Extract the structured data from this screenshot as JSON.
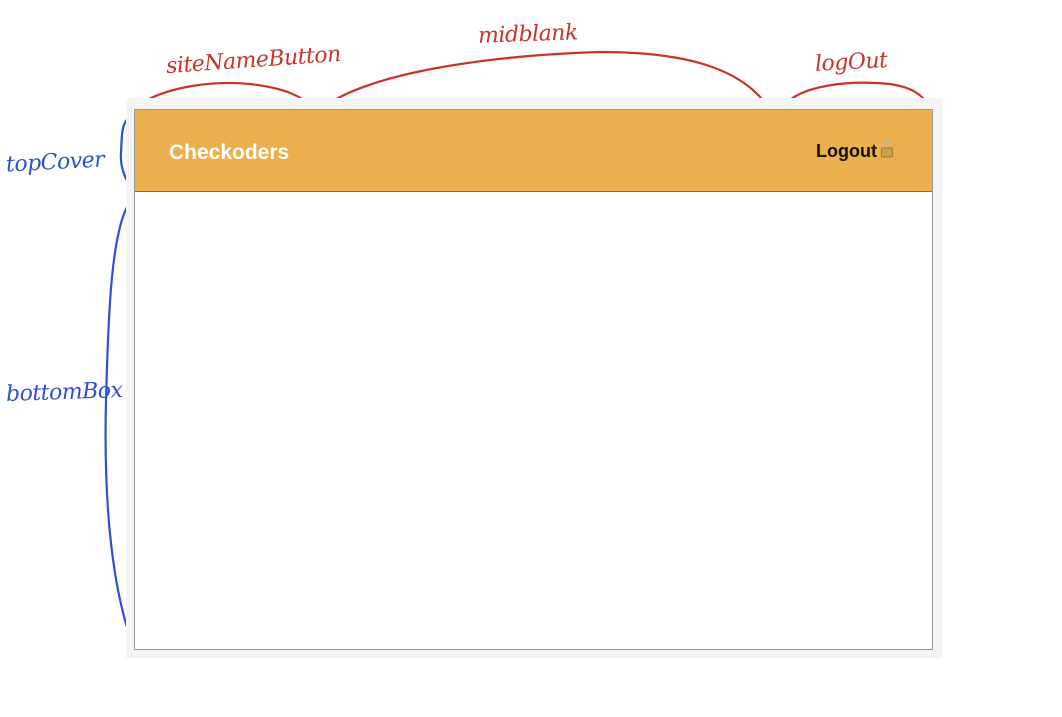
{
  "annotations": {
    "site_name_button": "siteNameButton",
    "mid_blank": "midblank",
    "log_out": "logOut",
    "top_cover": "topCover",
    "bottom_box": "bottomBox"
  },
  "header": {
    "site_name": "Checkoders",
    "logout_label": "Logout",
    "background_color": "#ebaf4c"
  },
  "icons": {
    "logout_icon": "lock-open-icon"
  }
}
